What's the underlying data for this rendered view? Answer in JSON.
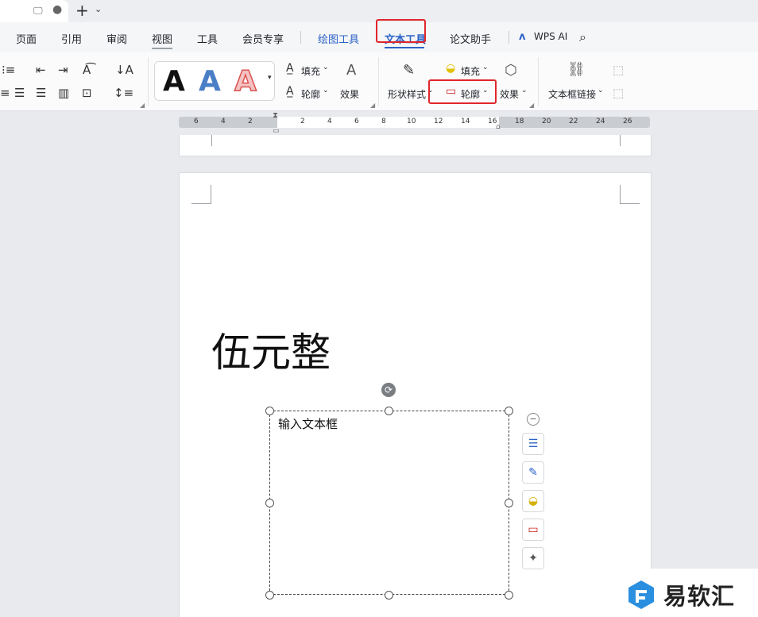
{
  "menu": {
    "items": [
      "页面",
      "引用",
      "审阅",
      "视图",
      "工具",
      "会员专享",
      "绘图工具",
      "文本工具",
      "论文助手",
      "WPS AI"
    ]
  },
  "ribbon": {
    "fill_label": "填充",
    "outline_label": "轮廓",
    "effect_label": "效果",
    "shape_style_label": "形状样式",
    "fill2_label": "填充",
    "outline2_label": "轮廓",
    "effect2_label": "效果",
    "textbox_link_label": "文本框链接",
    "style_letter": "A"
  },
  "ruler": {
    "left_numbers": [
      "6",
      "4",
      "2"
    ],
    "right_numbers": [
      "2",
      "4",
      "6",
      "8",
      "10",
      "12",
      "14",
      "16",
      "18",
      "20",
      "22",
      "24",
      "26"
    ]
  },
  "document": {
    "big_text": "伍元整",
    "textbox_text": "输入文本框"
  },
  "watermark": {
    "text": "易软汇"
  },
  "colors": {
    "accent_blue": "#2b63c6",
    "highlight_red": "#e0262b"
  }
}
